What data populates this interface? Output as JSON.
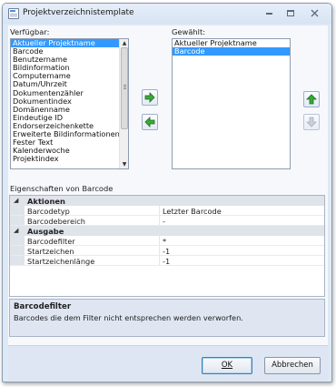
{
  "window": {
    "title": "Projektverzeichnistemplate"
  },
  "available": {
    "label": "Verfügbar:",
    "items": [
      "Aktueller Projektname",
      "Barcode",
      "Benutzername",
      "Bildinformation",
      "Computername",
      "Datum/Uhrzeit",
      "Dokumentenzähler",
      "Dokumentindex",
      "Domänenname",
      "Eindeutige ID",
      "Endorserzeichenkette",
      "Erweiterte Bildinformationen",
      "Fester Text",
      "Kalenderwoche",
      "Projektindex"
    ],
    "selected_index": 0
  },
  "selected": {
    "label": "Gewählt:",
    "items": [
      "Aktueller Projektname",
      "Barcode"
    ],
    "selected_index": 1
  },
  "arrows": {
    "add": "arrow-right-icon",
    "remove": "arrow-left-icon",
    "up": "arrow-up-icon",
    "down": "arrow-down-icon"
  },
  "properties": {
    "label": "Eigenschaften von Barcode",
    "categories": [
      {
        "name": "Aktionen",
        "rows": [
          {
            "name": "Barcodetyp",
            "value": "Letzter Barcode"
          },
          {
            "name": "Barcodebereich",
            "value": "-"
          }
        ]
      },
      {
        "name": "Ausgabe",
        "rows": [
          {
            "name": "Barcodefilter",
            "value": "*"
          },
          {
            "name": "Startzeichen",
            "value": "-1"
          },
          {
            "name": "Startzeichenlänge",
            "value": "-1"
          }
        ]
      }
    ]
  },
  "description": {
    "title": "Barcodefilter",
    "text": "Barcodes die dem Filter nicht entsprechen werden verworfen."
  },
  "buttons": {
    "ok": "OK",
    "cancel": "Abbrechen"
  },
  "colors": {
    "selection": "#3399ff",
    "green_arrow": "#3aa83a"
  }
}
